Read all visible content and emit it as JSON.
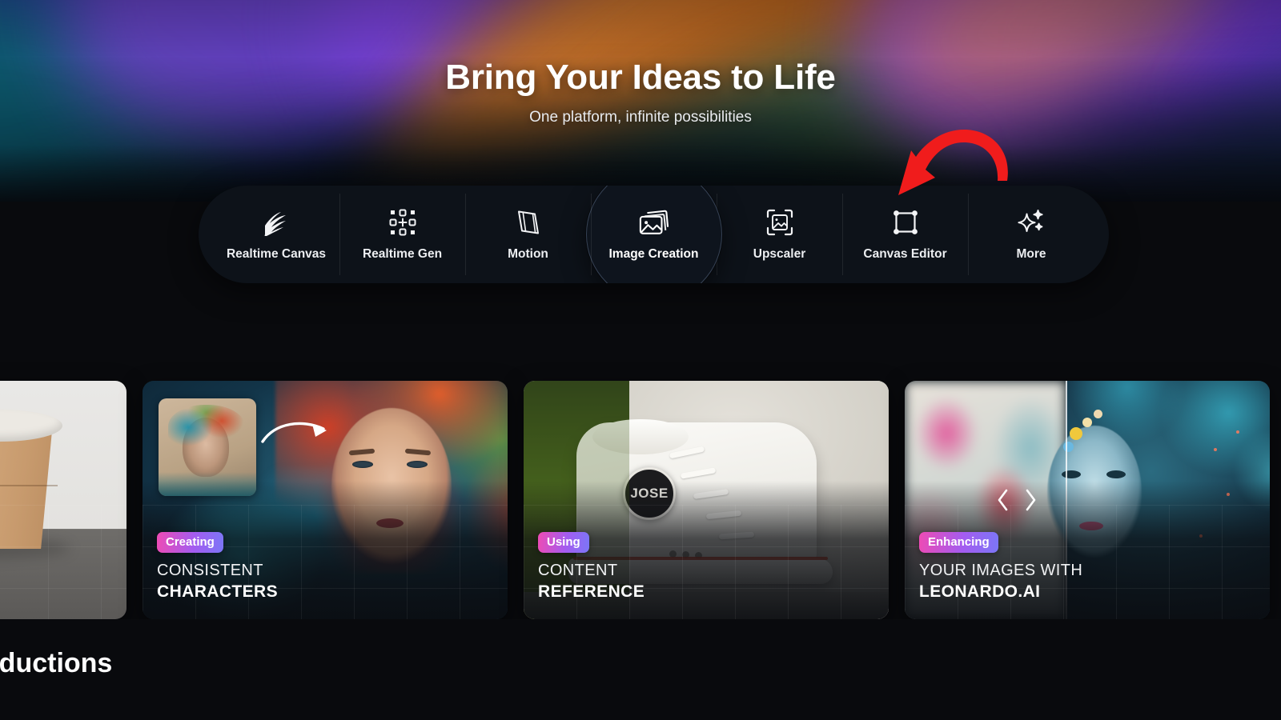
{
  "hero": {
    "title": "Bring Your Ideas to Life",
    "subtitle": "One platform, infinite possibilities"
  },
  "toolbar": {
    "items": [
      {
        "label": "Realtime Canvas",
        "icon": "scribble-icon",
        "active": false
      },
      {
        "label": "Realtime Gen",
        "icon": "grid-plus-icon",
        "active": false
      },
      {
        "label": "Motion",
        "icon": "film-strip-icon",
        "active": false
      },
      {
        "label": "Image Creation",
        "icon": "image-stack-icon",
        "active": true
      },
      {
        "label": "Upscaler",
        "icon": "image-frame-icon",
        "active": false
      },
      {
        "label": "Canvas Editor",
        "icon": "bounding-box-icon",
        "active": false
      },
      {
        "label": "More",
        "icon": "sparkles-icon",
        "active": false
      }
    ]
  },
  "annotation": {
    "type": "red-curved-arrow",
    "color": "#f01c1c",
    "points_to": "Canvas Editor"
  },
  "carousel": {
    "prev_icon": "chevron-left-icon",
    "next_icon": "chevron-right-icon",
    "cards": [
      {
        "badge": "",
        "line1": "",
        "line2": "",
        "art": "coffee-cup-photo"
      },
      {
        "badge": "Creating",
        "line1": "CONSISTENT",
        "line2": "CHARACTERS",
        "art": "character-reference-photo"
      },
      {
        "badge": "Using",
        "line1": "CONTENT",
        "line2": "REFERENCE",
        "art": "sneaker-photo"
      },
      {
        "badge": "Enhancing",
        "line1": "YOUR IMAGES WITH",
        "line2": "LEONARDO.AI",
        "art": "upscaler-comparison-photo"
      }
    ]
  },
  "bottom": {
    "section_title": "Productions"
  },
  "colors": {
    "page_background": "#090a0d",
    "toolbar_background": "#0d1219",
    "badge_gradient_start": "#ee4bb4",
    "badge_gradient_end": "#7b76f7",
    "annotation_red": "#f01c1c",
    "text_primary": "#ffffff"
  },
  "shoe_badge_text": "JOSE"
}
